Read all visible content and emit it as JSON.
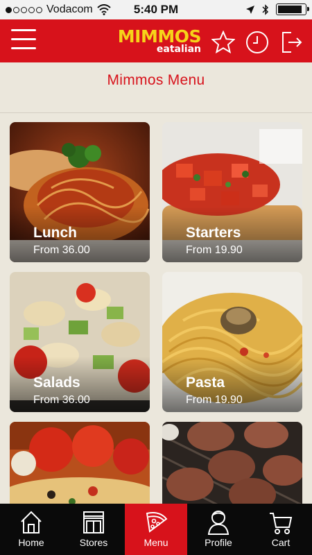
{
  "status_bar": {
    "carrier": "Vodacom",
    "time": "5:40 PM",
    "battery_level": 0.92
  },
  "header": {
    "logo_text": "MIMMOS",
    "logo_subtext": "eatalian"
  },
  "page_title": "Mimmos Menu",
  "categories": [
    {
      "name": "Lunch",
      "price": "From 36.00"
    },
    {
      "name": "Starters",
      "price": "From 19.90"
    },
    {
      "name": "Salads",
      "price": "From 36.00"
    },
    {
      "name": "Pasta",
      "price": "From 19.90"
    },
    {
      "name": "",
      "price": ""
    },
    {
      "name": "",
      "price": ""
    }
  ],
  "tabs": [
    {
      "label": "Home",
      "icon": "house-icon"
    },
    {
      "label": "Stores",
      "icon": "storefront-icon"
    },
    {
      "label": "Menu",
      "icon": "pizza-slice-icon",
      "active": true
    },
    {
      "label": "Profile",
      "icon": "person-icon"
    },
    {
      "label": "Cart",
      "icon": "cart-icon"
    }
  ],
  "colors": {
    "brand_red": "#d7121b",
    "logo_yellow": "#f6d41a",
    "background": "#ebe7dc",
    "tabbar": "#0a0a0a"
  }
}
